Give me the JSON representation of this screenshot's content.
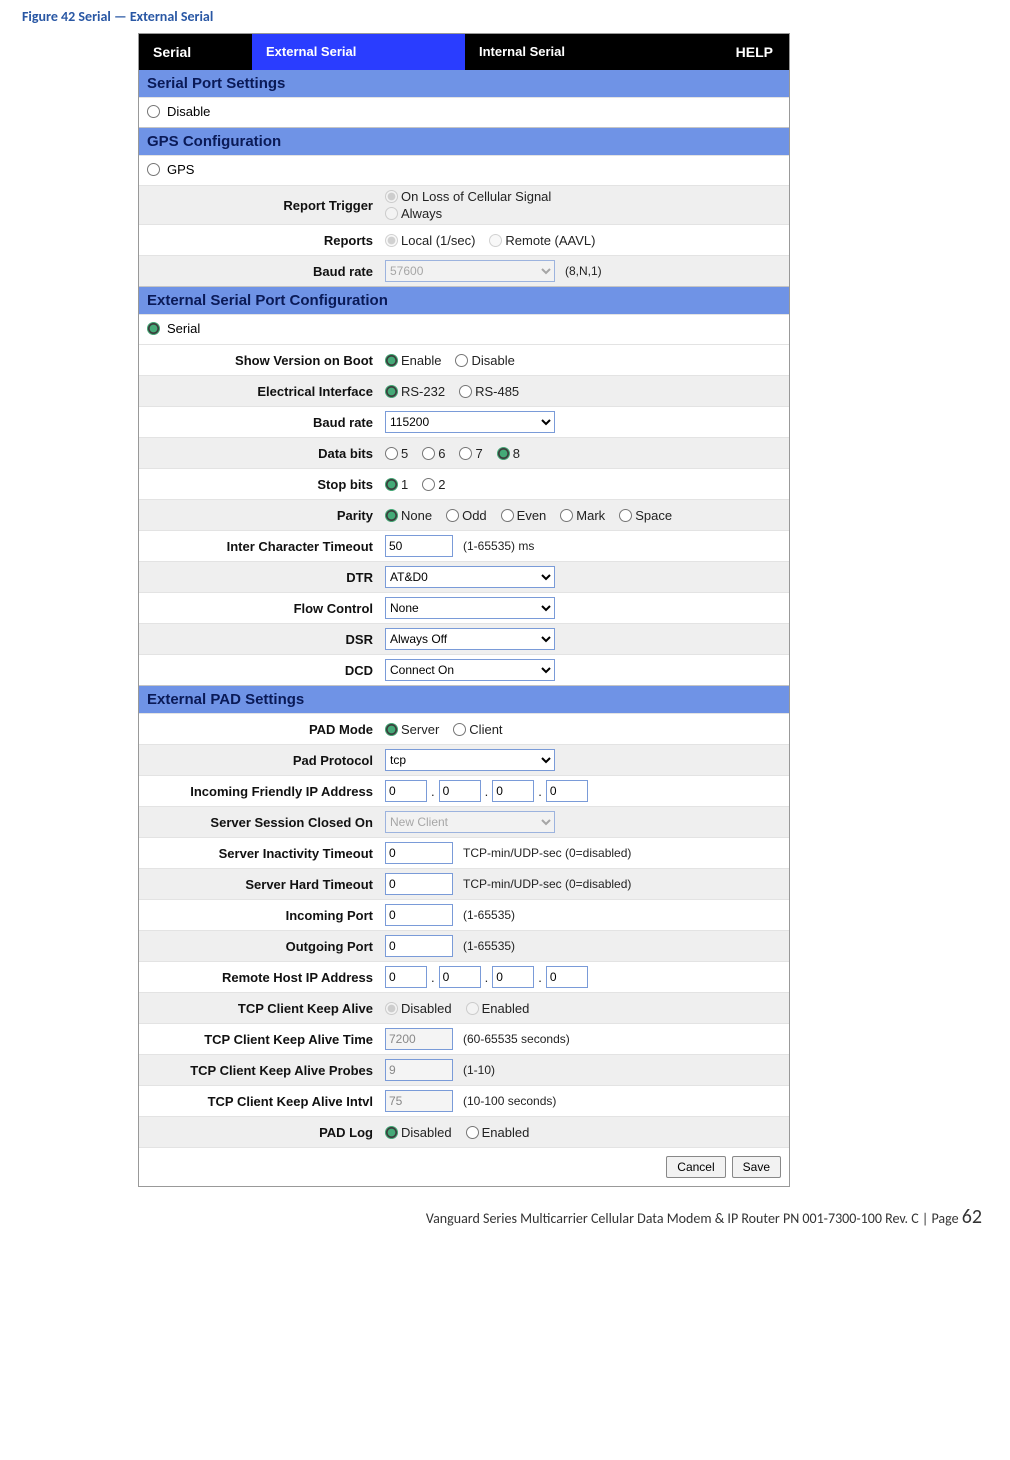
{
  "caption": "Figure 42 Serial — External Serial",
  "tabs": {
    "serial": "Serial",
    "external": "External Serial",
    "internal": "Internal Serial",
    "help": "HELP"
  },
  "sections": {
    "serial_port": "Serial Port Settings",
    "gps_conf": "GPS Configuration",
    "ext_port": "External Serial Port Configuration",
    "ext_pad": "External PAD Settings"
  },
  "disable_label": "Disable",
  "gps_label": "GPS",
  "serial_radio_label": "Serial",
  "gps": {
    "report_trigger_lbl": "Report Trigger",
    "trigger_opt1": "On Loss of Cellular Signal",
    "trigger_opt2": "Always",
    "reports_lbl": "Reports",
    "reports_opt1": "Local (1/sec)",
    "reports_opt2": "Remote (AAVL)",
    "baud_lbl": "Baud rate",
    "baud_val": "57600",
    "baud_hint": "(8,N,1)"
  },
  "ext": {
    "show_ver_lbl": "Show Version on Boot",
    "enable": "Enable",
    "disable": "Disable",
    "elec_lbl": "Electrical Interface",
    "rs232": "RS-232",
    "rs485": "RS-485",
    "baud_lbl": "Baud rate",
    "baud_val": "115200",
    "databits_lbl": "Data bits",
    "db5": "5",
    "db6": "6",
    "db7": "7",
    "db8": "8",
    "stopbits_lbl": "Stop bits",
    "sb1": "1",
    "sb2": "2",
    "parity_lbl": "Parity",
    "p_none": "None",
    "p_odd": "Odd",
    "p_even": "Even",
    "p_mark": "Mark",
    "p_space": "Space",
    "ict_lbl": "Inter Character Timeout",
    "ict_val": "50",
    "ict_hint": "(1-65535) ms",
    "dtr_lbl": "DTR",
    "dtr_val": "AT&D0",
    "flow_lbl": "Flow Control",
    "flow_val": "None",
    "dsr_lbl": "DSR",
    "dsr_val": "Always Off",
    "dcd_lbl": "DCD",
    "dcd_val": "Connect On"
  },
  "pad": {
    "mode_lbl": "PAD Mode",
    "mode_server": "Server",
    "mode_client": "Client",
    "proto_lbl": "Pad Protocol",
    "proto_val": "tcp",
    "ifip_lbl": "Incoming Friendly IP Address",
    "ip0": "0",
    "ip1": "0",
    "ip2": "0",
    "ip3": "0",
    "ssc_lbl": "Server Session Closed On",
    "ssc_val": "New Client",
    "sit_lbl": "Server Inactivity Timeout",
    "sit_val": "0",
    "sit_hint": "TCP-min/UDP-sec (0=disabled)",
    "sht_lbl": "Server Hard Timeout",
    "sht_val": "0",
    "sht_hint": "TCP-min/UDP-sec (0=disabled)",
    "inport_lbl": "Incoming Port",
    "inport_val": "0",
    "inport_hint": "(1-65535)",
    "outport_lbl": "Outgoing Port",
    "outport_val": "0",
    "outport_hint": "(1-65535)",
    "rhost_lbl": "Remote Host IP Address",
    "rh0": "0",
    "rh1": "0",
    "rh2": "0",
    "rh3": "0",
    "ka_lbl": "TCP Client Keep Alive",
    "ka_disabled": "Disabled",
    "ka_enabled": "Enabled",
    "kat_lbl": "TCP Client Keep Alive Time",
    "kat_val": "7200",
    "kat_hint": "(60-65535 seconds)",
    "kap_lbl": "TCP Client Keep Alive Probes",
    "kap_val": "9",
    "kap_hint": "(1-10)",
    "kai_lbl": "TCP Client Keep Alive Intvl",
    "kai_val": "75",
    "kai_hint": "(10-100 seconds)",
    "padlog_lbl": "PAD Log"
  },
  "buttons": {
    "cancel": "Cancel",
    "save": "Save"
  },
  "footer": {
    "text": "Vanguard Series Multicarrier Cellular Data Modem & IP Router PN 001-7300-100 Rev. C",
    "page_word": " | Page ",
    "page_num": "62"
  }
}
